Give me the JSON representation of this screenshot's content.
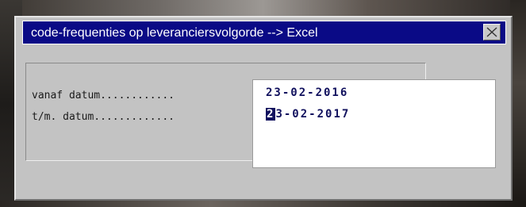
{
  "dialog": {
    "title": "code-frequenties op leveranciersvolgorde  --> Excel",
    "close_symbol": "close-icon"
  },
  "form": {
    "from_label": "vanaf datum............",
    "to_label": "t/m. datum.............",
    "from_value": "23-02-2016",
    "to_value_cursor_char": "2",
    "to_value_rest": "3-02-2017"
  },
  "colors": {
    "titlebar": "#0a0a86",
    "dialog_bg": "#c3c3c3",
    "value_text": "#11115e"
  }
}
